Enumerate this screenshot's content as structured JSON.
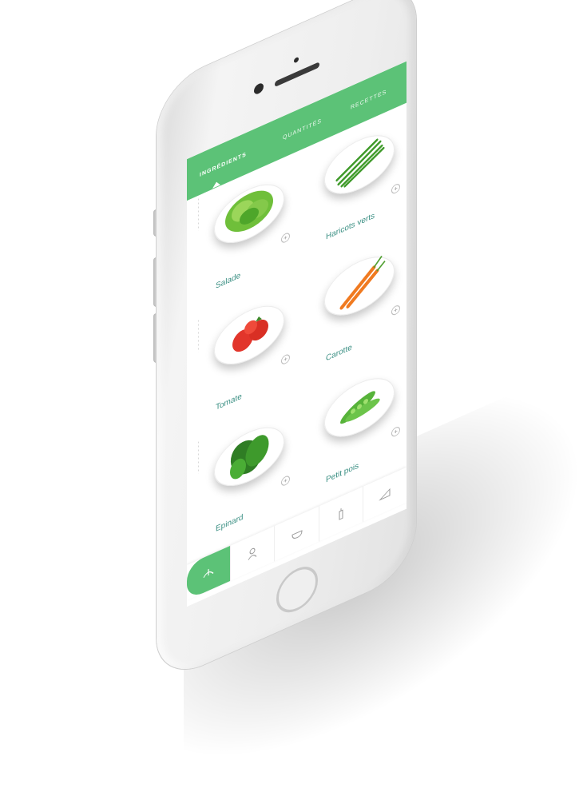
{
  "tabs": [
    {
      "label": "Ingrédients",
      "active": true
    },
    {
      "label": "Quantités",
      "active": false
    },
    {
      "label": "Recettes",
      "active": false
    }
  ],
  "ingredients": [
    {
      "name": "Salade",
      "icon": "lettuce-icon"
    },
    {
      "name": "Haricots verts",
      "icon": "green-beans-icon"
    },
    {
      "name": "Tomate",
      "icon": "tomato-icon"
    },
    {
      "name": "Carotte",
      "icon": "carrot-icon"
    },
    {
      "name": "Epinard",
      "icon": "spinach-icon"
    },
    {
      "name": "Petit pois",
      "icon": "peas-icon"
    }
  ],
  "add_symbol": "+",
  "bottom_nav": [
    {
      "icon": "vegetables-icon",
      "active": true
    },
    {
      "icon": "chef-icon",
      "active": false
    },
    {
      "icon": "bowl-icon",
      "active": false
    },
    {
      "icon": "bottle-icon",
      "active": false
    },
    {
      "icon": "cheese-icon",
      "active": false
    }
  ],
  "colors": {
    "accent": "#5cc277",
    "label": "#3a8f83"
  }
}
